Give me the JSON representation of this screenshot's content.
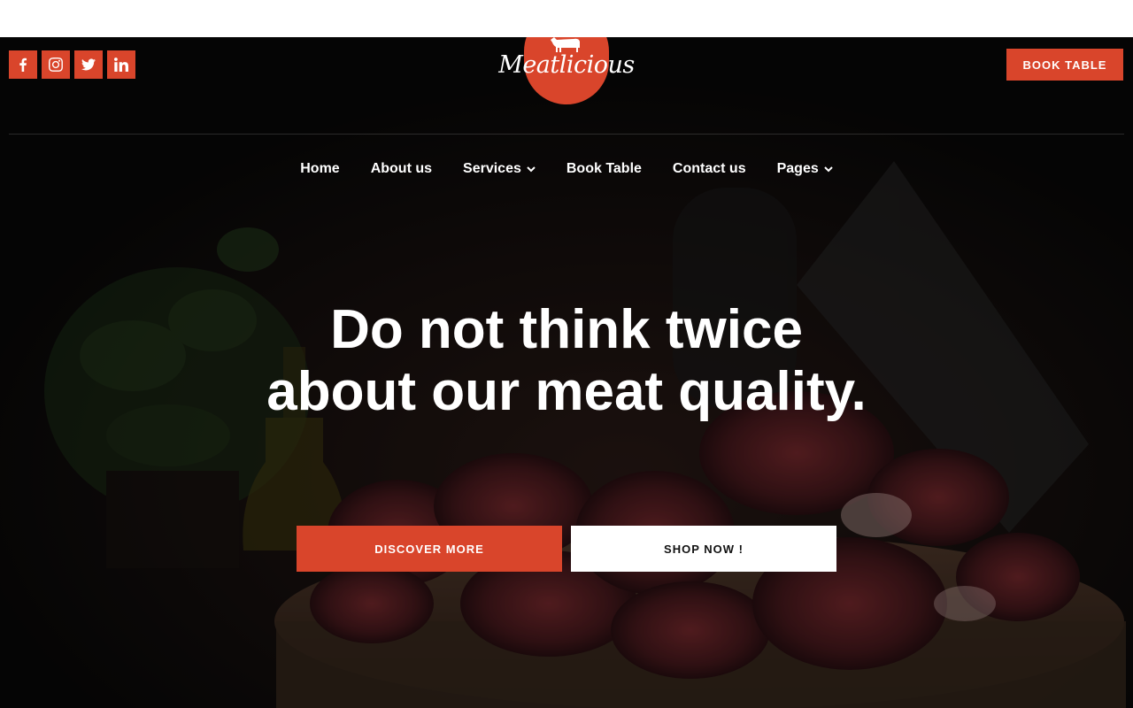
{
  "brand": {
    "name": "Meatlicious",
    "stars": "★★★",
    "accent": "#d9452b"
  },
  "social": [
    {
      "icon": "facebook-icon"
    },
    {
      "icon": "instagram-icon"
    },
    {
      "icon": "twitter-icon"
    },
    {
      "icon": "linkedin-icon"
    }
  ],
  "header": {
    "book_label": "BOOK TABLE"
  },
  "nav": {
    "home": "Home",
    "about": "About us",
    "services": "Services",
    "book": "Book Table",
    "contact": "Contact us",
    "pages": "Pages"
  },
  "hero": {
    "line1": "Do not think twice",
    "line2": "about our meat quality.",
    "discover_label": "DISCOVER MORE",
    "shop_label": "SHOP NOW !"
  }
}
